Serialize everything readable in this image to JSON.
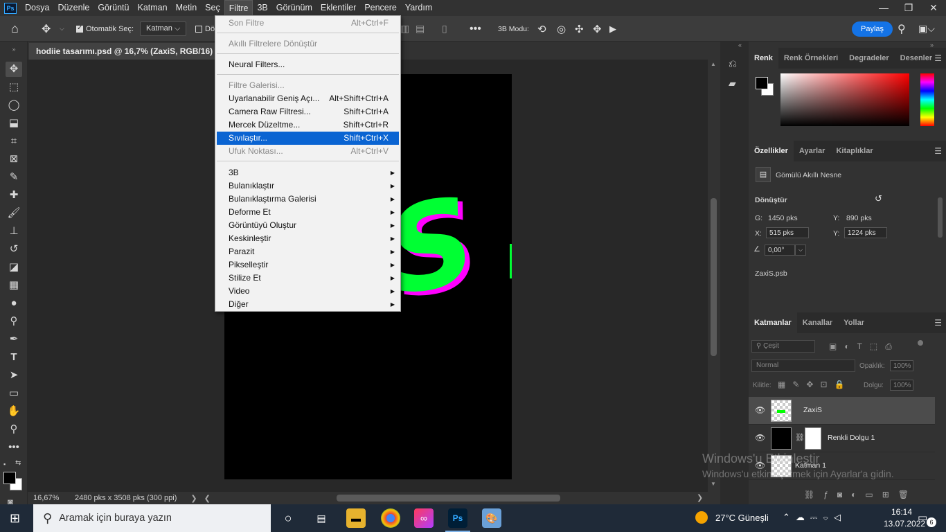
{
  "app": {
    "logo": "Ps",
    "menu": [
      "Dosya",
      "Düzenle",
      "Görüntü",
      "Katman",
      "Metin",
      "Seç",
      "Filtre",
      "3B",
      "Görünüm",
      "Eklentiler",
      "Pencere",
      "Yardım"
    ],
    "active_menu": "Filtre",
    "window_buttons": [
      "—",
      "❐",
      "✕"
    ]
  },
  "options": {
    "auto_select_label": "Otomatik Seç:",
    "auto_select_value": "Katman",
    "partial_label": "Dö",
    "mode_label": "3B Modu:",
    "share_label": "Paylaş"
  },
  "document": {
    "tab_title": "hodiie tasarımı.psd @ 16,7% (ZaxiS, RGB/16) *",
    "zoom": "16,67%",
    "doc_info": "2480 pks x 3508 pks (300 ppi)",
    "artwork_text": "S"
  },
  "filter_menu": {
    "items": [
      {
        "label": "Son Filtre",
        "shortcut": "Alt+Ctrl+F",
        "state": "disabled"
      },
      {
        "label": "Akıllı Filtrelere Dönüştür",
        "shortcut": "",
        "state": "disabled"
      },
      {
        "label": "Neural Filters...",
        "shortcut": "",
        "state": "normal"
      },
      {
        "label": "Filtre Galerisi...",
        "shortcut": "",
        "state": "disabled"
      },
      {
        "label": "Uyarlanabilir Geniş Açı...",
        "shortcut": "Alt+Shift+Ctrl+A",
        "state": "normal"
      },
      {
        "label": "Camera Raw Filtresi...",
        "shortcut": "Shift+Ctrl+A",
        "state": "normal"
      },
      {
        "label": "Mercek Düzeltme...",
        "shortcut": "Shift+Ctrl+R",
        "state": "normal"
      },
      {
        "label": "Sıvılaştır...",
        "shortcut": "Shift+Ctrl+X",
        "state": "highlighted"
      },
      {
        "label": "Ufuk Noktası...",
        "shortcut": "Alt+Ctrl+V",
        "state": "disabled"
      },
      {
        "label": "3B",
        "shortcut": "",
        "state": "submenu"
      },
      {
        "label": "Bulanıklaştır",
        "shortcut": "",
        "state": "submenu"
      },
      {
        "label": "Bulanıklaştırma Galerisi",
        "shortcut": "",
        "state": "submenu"
      },
      {
        "label": "Deforme Et",
        "shortcut": "",
        "state": "submenu"
      },
      {
        "label": "Görüntüyü Oluştur",
        "shortcut": "",
        "state": "submenu"
      },
      {
        "label": "Keskinleştir",
        "shortcut": "",
        "state": "submenu"
      },
      {
        "label": "Parazit",
        "shortcut": "",
        "state": "submenu"
      },
      {
        "label": "Pikselleştir",
        "shortcut": "",
        "state": "submenu"
      },
      {
        "label": "Stilize Et",
        "shortcut": "",
        "state": "submenu"
      },
      {
        "label": "Video",
        "shortcut": "",
        "state": "submenu"
      },
      {
        "label": "Diğer",
        "shortcut": "",
        "state": "submenu"
      }
    ]
  },
  "color_panel": {
    "tabs": [
      "Renk",
      "Renk Örnekleri",
      "Degradeler",
      "Desenler"
    ],
    "active_tab": "Renk",
    "fg_color": "#000000",
    "bg_color": "#ffffff",
    "hue_color": "#ff0000"
  },
  "properties_panel": {
    "tabs": [
      "Özellikler",
      "Ayarlar",
      "Kitaplıklar"
    ],
    "active_tab": "Özellikler",
    "object_type": "Gömülü Akıllı Nesne",
    "section": "Dönüştür",
    "w_label": "G:",
    "w_value": "1450 pks",
    "h_label": "Y:",
    "h_value": "890 pks",
    "x_label": "X:",
    "x_value": "515 pks",
    "y_label": "Y:",
    "y_value": "1224 pks",
    "angle_value": "0,00°",
    "file_name": "ZaxiS.psb"
  },
  "layers_panel": {
    "tabs": [
      "Katmanlar",
      "Kanallar",
      "Yollar"
    ],
    "active_tab": "Katmanlar",
    "filter_placeholder": "Çeşit",
    "blend_mode": "Normal",
    "opacity_label": "Opaklık:",
    "opacity_value": "100%",
    "lock_label": "Kilitle:",
    "fill_label": "Dolgu:",
    "fill_value": "100%",
    "layers": [
      {
        "name": "ZaxiS",
        "selected": true
      },
      {
        "name": "Renkli Dolgu 1",
        "selected": false
      },
      {
        "name": "Katman 1",
        "selected": false
      }
    ]
  },
  "watermark": {
    "line1": "Windows'u Etkinleştir",
    "line2": "Windows'u etkinleştirmek için Ayarlar'a gidin."
  },
  "taskbar": {
    "search_placeholder": "Aramak için buraya yazın",
    "weather": "27°C  Güneşli",
    "time": "16:14",
    "date": "13.07.2022",
    "notifications": "6"
  }
}
